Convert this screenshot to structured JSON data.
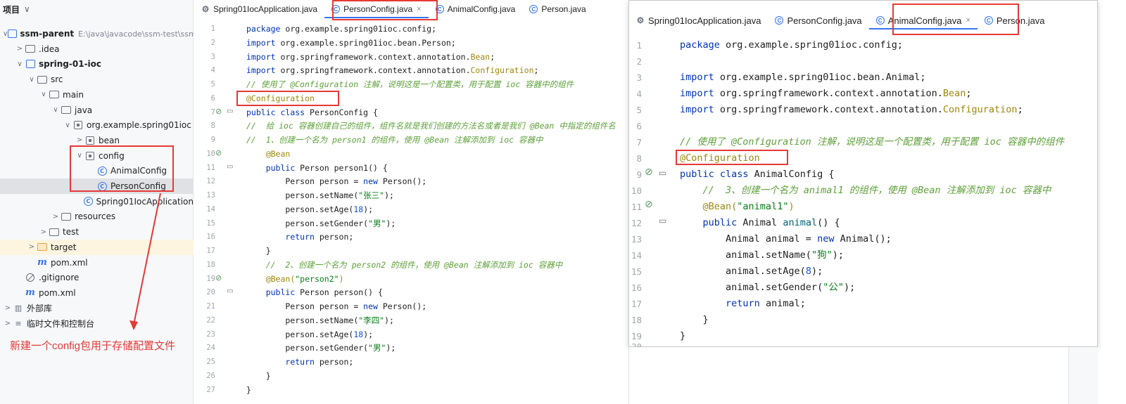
{
  "project": {
    "header": "项目",
    "rows": [
      {
        "indent": 0,
        "arrow": "∨",
        "icon": "module",
        "label": "ssm-parent",
        "hint": "E:\\java\\javacode\\ssm-test\\ssm-p",
        "bold": true
      },
      {
        "indent": 1,
        "arrow": ">",
        "icon": "folder",
        "label": ".idea"
      },
      {
        "indent": 1,
        "arrow": "∨",
        "icon": "module",
        "label": "spring-01-ioc",
        "bold": true
      },
      {
        "indent": 2,
        "arrow": "∨",
        "icon": "folder",
        "label": "src"
      },
      {
        "indent": 3,
        "arrow": "∨",
        "icon": "folder",
        "label": "main"
      },
      {
        "indent": 4,
        "arrow": "∨",
        "icon": "folder",
        "label": "java"
      },
      {
        "indent": 5,
        "arrow": "∨",
        "icon": "package",
        "label": "org.example.spring01ioc"
      },
      {
        "indent": 6,
        "arrow": ">",
        "icon": "package",
        "label": "bean"
      },
      {
        "indent": 6,
        "arrow": "∨",
        "icon": "package",
        "label": "config"
      },
      {
        "indent": 7,
        "arrow": "",
        "icon": "class",
        "label": "AnimalConfig"
      },
      {
        "indent": 7,
        "arrow": "",
        "icon": "class",
        "label": "PersonConfig",
        "selected": true
      },
      {
        "indent": 6,
        "arrow": "",
        "icon": "class",
        "label": "Spring01IocApplication"
      },
      {
        "indent": 4,
        "arrow": ">",
        "icon": "folder",
        "label": "resources"
      },
      {
        "indent": 3,
        "arrow": ">",
        "icon": "folder",
        "label": "test"
      },
      {
        "indent": 2,
        "arrow": ">",
        "icon": "folder-orange",
        "label": "target",
        "target": true
      },
      {
        "indent": 2,
        "arrow": "",
        "icon": "maven",
        "label": "pom.xml"
      },
      {
        "indent": 1,
        "arrow": "",
        "icon": "ignore",
        "label": ".gitignore"
      },
      {
        "indent": 1,
        "arrow": "",
        "icon": "maven",
        "label": "pom.xml"
      },
      {
        "indent": 0,
        "arrow": ">",
        "icon": "library",
        "label": "外部库"
      },
      {
        "indent": 0,
        "arrow": ">",
        "icon": "scratch",
        "label": "临时文件和控制台"
      }
    ],
    "annotation": "新建一个config包用于存储配置文件"
  },
  "left_editor": {
    "tabs": [
      {
        "label": "Spring01IocApplication.java",
        "icon": "spring-icon"
      },
      {
        "label": "PersonConfig.java",
        "icon": "class-icon",
        "active": true,
        "close": "×"
      },
      {
        "label": "AnimalConfig.java",
        "icon": "class-icon"
      },
      {
        "label": "Person.java",
        "icon": "class-icon"
      }
    ],
    "lines": [
      [
        {
          "t": "package ",
          "c": "kw"
        },
        {
          "t": "org.example.spring01ioc.config;"
        }
      ],
      [
        {
          "t": "import ",
          "c": "kw"
        },
        {
          "t": "org.example.spring01ioc.bean.Person;"
        }
      ],
      [
        {
          "t": "import ",
          "c": "kw"
        },
        {
          "t": "org.springframework.context.annotation."
        },
        {
          "t": "Bean",
          "c": "ann"
        },
        {
          "t": ";"
        }
      ],
      [
        {
          "t": "import ",
          "c": "kw"
        },
        {
          "t": "org.springframework.context.annotation."
        },
        {
          "t": "Configuration",
          "c": "ann"
        },
        {
          "t": ";"
        }
      ],
      [
        {
          "t": "// 使用了 @Configuration 注解，说明这是一个配置类，用于配置 ioc 容器中的组件",
          "c": "cmt"
        }
      ],
      [
        {
          "t": "@Configuration",
          "c": "ann"
        }
      ],
      [
        {
          "t": "public class ",
          "c": "kw"
        },
        {
          "t": "PersonConfig {"
        }
      ],
      [
        {
          "t": "//  给 ioc 容器创建自己的组件，组件名就是我们创建的方法名或者是我们 @Bean 中指定的组件名",
          "c": "cmt"
        }
      ],
      [
        {
          "t": "//  1、创建一个名为 person1 的组件，使用 @Bean 注解添加到 ioc 容器中",
          "c": "cmt"
        }
      ],
      [
        {
          "t": "    "
        },
        {
          "t": "@Bean",
          "c": "ann"
        }
      ],
      [
        {
          "t": "    "
        },
        {
          "t": "public ",
          "c": "kw"
        },
        {
          "t": "Person person1() {"
        }
      ],
      [
        {
          "t": "        Person person = "
        },
        {
          "t": "new ",
          "c": "kw"
        },
        {
          "t": "Person();"
        }
      ],
      [
        {
          "t": "        person.setName("
        },
        {
          "t": "\"张三\"",
          "c": "str"
        },
        {
          "t": ");"
        }
      ],
      [
        {
          "t": "        person.setAge("
        },
        {
          "t": "18",
          "c": "num"
        },
        {
          "t": ");"
        }
      ],
      [
        {
          "t": "        person.setGender("
        },
        {
          "t": "\"男\"",
          "c": "str"
        },
        {
          "t": ");"
        }
      ],
      [
        {
          "t": "        "
        },
        {
          "t": "return ",
          "c": "kw"
        },
        {
          "t": "person;"
        }
      ],
      [
        {
          "t": "    }"
        }
      ],
      [
        {
          "t": "    //  2、创建一个名为 person2 的组件，使用 @Bean 注解添加到 ioc 容器中",
          "c": "cmt"
        }
      ],
      [
        {
          "t": "    "
        },
        {
          "t": "@Bean(",
          "c": "ann"
        },
        {
          "t": "\"person2\"",
          "c": "str"
        },
        {
          "t": ")",
          "c": "ann"
        }
      ],
      [
        {
          "t": "    "
        },
        {
          "t": "public ",
          "c": "kw"
        },
        {
          "t": "Person person() {"
        }
      ],
      [
        {
          "t": "        Person person = "
        },
        {
          "t": "new ",
          "c": "kw"
        },
        {
          "t": "Person();"
        }
      ],
      [
        {
          "t": "        person.setName("
        },
        {
          "t": "\"李四\"",
          "c": "str"
        },
        {
          "t": ");"
        }
      ],
      [
        {
          "t": "        person.setAge("
        },
        {
          "t": "18",
          "c": "num"
        },
        {
          "t": ");"
        }
      ],
      [
        {
          "t": "        person.setGender("
        },
        {
          "t": "\"男\"",
          "c": "str"
        },
        {
          "t": ");"
        }
      ],
      [
        {
          "t": "        "
        },
        {
          "t": "return ",
          "c": "kw"
        },
        {
          "t": "person;"
        }
      ],
      [
        {
          "t": "    }"
        }
      ],
      [
        {
          "t": "}"
        }
      ]
    ]
  },
  "right_editor": {
    "tabs": [
      {
        "label": "Spring01IocApplication.java",
        "icon": "spring-icon"
      },
      {
        "label": "PersonConfig.java",
        "icon": "class-icon"
      },
      {
        "label": "AnimalConfig.java",
        "icon": "class-icon",
        "active": true,
        "close": "×"
      },
      {
        "label": "Person.java",
        "icon": "class-icon"
      }
    ],
    "lines": [
      [
        {
          "t": "package ",
          "c": "kw"
        },
        {
          "t": "org.example.spring01ioc.config;"
        }
      ],
      [
        {
          "t": ""
        }
      ],
      [
        {
          "t": "import ",
          "c": "kw"
        },
        {
          "t": "org.example.spring01ioc.bean.Animal;"
        }
      ],
      [
        {
          "t": "import ",
          "c": "kw"
        },
        {
          "t": "org.springframework.context.annotation."
        },
        {
          "t": "Bean",
          "c": "ann"
        },
        {
          "t": ";"
        }
      ],
      [
        {
          "t": "import ",
          "c": "kw"
        },
        {
          "t": "org.springframework.context.annotation."
        },
        {
          "t": "Configuration",
          "c": "ann"
        },
        {
          "t": ";"
        }
      ],
      [
        {
          "t": ""
        }
      ],
      [
        {
          "t": "// 使用了 @Configuration 注解，说明这是一个配置类，用于配置 ioc 容器中的组件",
          "c": "cmt"
        }
      ],
      [
        {
          "t": "@Configuration",
          "c": "ann"
        }
      ],
      [
        {
          "t": "public class ",
          "c": "kw"
        },
        {
          "t": "AnimalConfig {"
        }
      ],
      [
        {
          "t": "    //  3、创建一个名为 animal1 的组件，使用 @Bean 注解添加到 ioc 容器中",
          "c": "cmt"
        }
      ],
      [
        {
          "t": "    "
        },
        {
          "t": "@Bean(",
          "c": "ann"
        },
        {
          "t": "\"animal1\"",
          "c": "str"
        },
        {
          "t": ")",
          "c": "ann"
        }
      ],
      [
        {
          "t": "    "
        },
        {
          "t": "public ",
          "c": "kw"
        },
        {
          "t": "Animal "
        },
        {
          "t": "animal",
          "c": "fn"
        },
        {
          "t": "() {"
        }
      ],
      [
        {
          "t": "        Animal animal = "
        },
        {
          "t": "new ",
          "c": "kw"
        },
        {
          "t": "Animal();"
        }
      ],
      [
        {
          "t": "        animal.setName("
        },
        {
          "t": "\"狗\"",
          "c": "str"
        },
        {
          "t": ");"
        }
      ],
      [
        {
          "t": "        animal.setAge("
        },
        {
          "t": "8",
          "c": "num"
        },
        {
          "t": ");"
        }
      ],
      [
        {
          "t": "        animal.setGender("
        },
        {
          "t": "\"公\"",
          "c": "str"
        },
        {
          "t": ");"
        }
      ],
      [
        {
          "t": "        "
        },
        {
          "t": "return ",
          "c": "kw"
        },
        {
          "t": "animal;"
        }
      ],
      [
        {
          "t": "    }"
        }
      ],
      [
        {
          "t": "}"
        }
      ]
    ],
    "partial_line_number": "20"
  },
  "colors": {
    "accent": "#3574f0",
    "annotation_red": "#e53935",
    "keyword": "#0033b3",
    "annotation": "#9e880d",
    "comment": "#5fa03b",
    "string": "#067d17"
  }
}
